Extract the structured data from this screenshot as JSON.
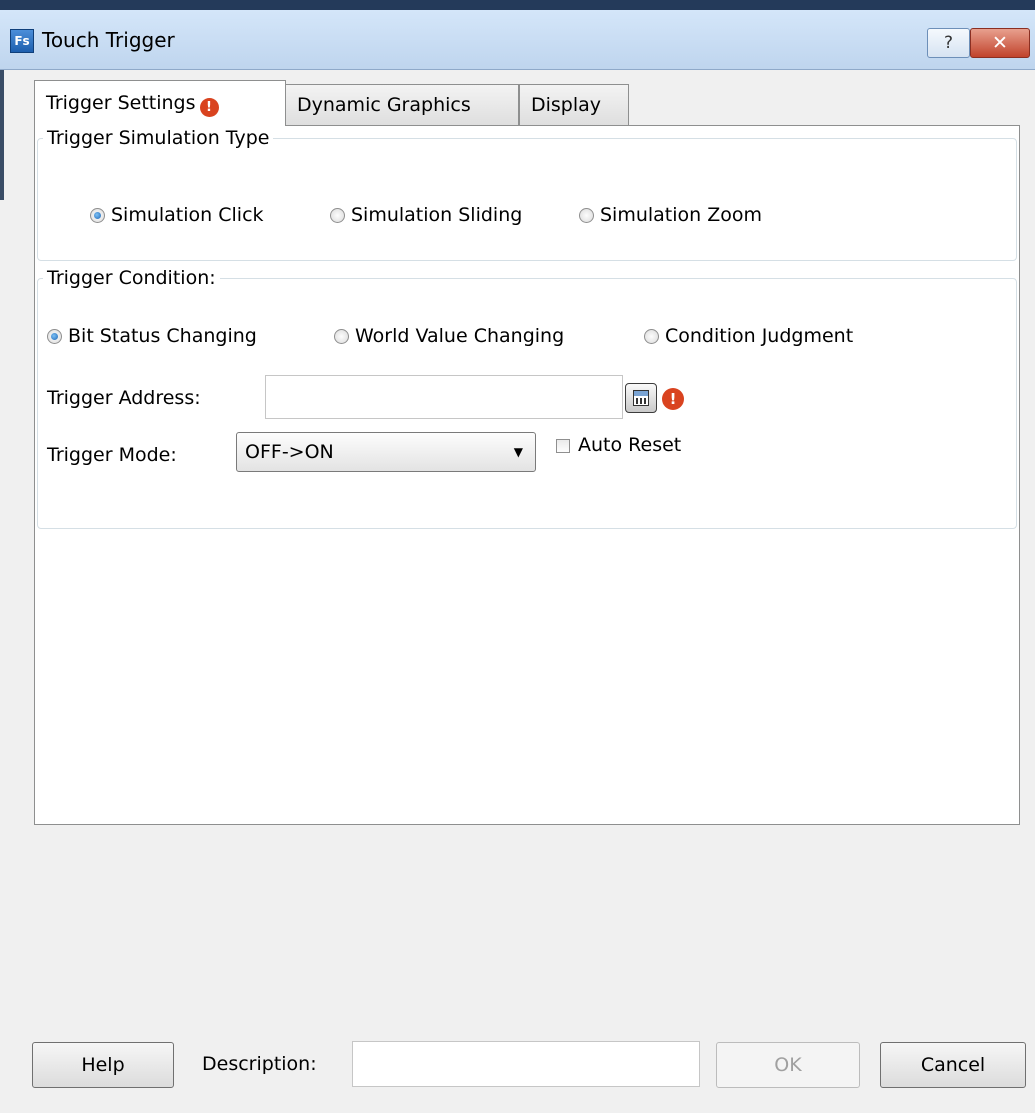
{
  "window": {
    "title": "Touch Trigger",
    "app_icon": "Fs",
    "help_glyph": "?",
    "close_glyph": "✕"
  },
  "tabs": [
    {
      "label": "Trigger Settings",
      "active": true,
      "warning": true
    },
    {
      "label": "Dynamic Graphics",
      "active": false
    },
    {
      "label": "Display",
      "active": false
    }
  ],
  "simulation_group": {
    "legend": "Trigger Simulation Type",
    "options": [
      "Simulation Click",
      "Simulation Sliding",
      "Simulation Zoom"
    ],
    "selected": "Simulation Click"
  },
  "condition_group": {
    "legend": "Trigger Condition:",
    "options": [
      "Bit Status Changing",
      "World Value Changing",
      "Condition Judgment"
    ],
    "selected": "Bit Status Changing",
    "address_label": "Trigger Address:",
    "address_value": "",
    "mode_label": "Trigger Mode:",
    "mode_value": "OFF->ON",
    "auto_reset_label": "Auto Reset",
    "auto_reset_checked": false
  },
  "footer": {
    "help_label": "Help",
    "description_label": "Description:",
    "description_value": "",
    "ok_label": "OK",
    "ok_enabled": false,
    "cancel_label": "Cancel"
  },
  "icons": {
    "warning": "exclamation-icon",
    "calculator": "calculator-icon",
    "dropdown": "chevron-down-icon"
  },
  "colors": {
    "titlebar": "#c9ddf3",
    "warning": "#d9431f",
    "radio_selected": "#1f66b5",
    "background": "#f0f0f0"
  }
}
